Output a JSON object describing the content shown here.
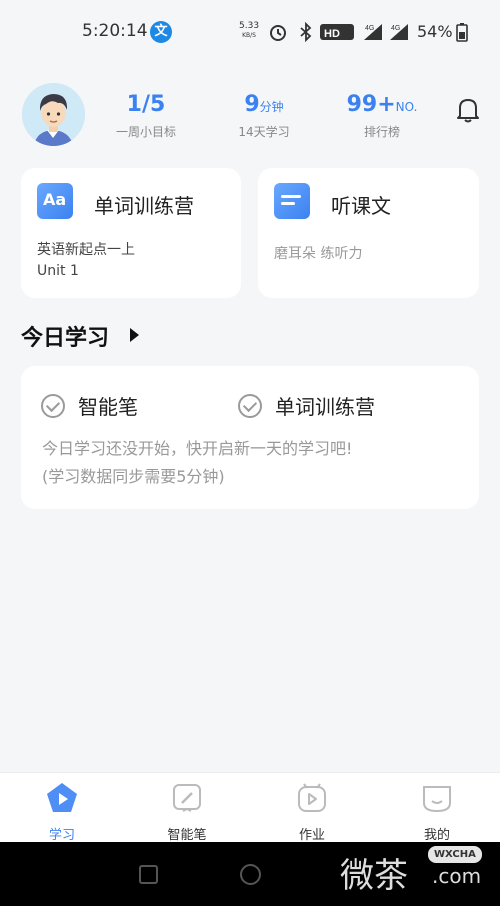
{
  "status": {
    "time": "5:20:14",
    "net_speed_value": "5.33",
    "net_speed_unit": "KB/S",
    "hd_label": "HD",
    "battery": "54%"
  },
  "header": {
    "goal_value": "1/5",
    "goal_label": "一周小目标",
    "minutes_value": "9",
    "minutes_unit": "分钟",
    "minutes_label": "14天学习",
    "rank_value": "99+",
    "rank_unit": "NO.",
    "rank_label": "排行榜"
  },
  "cards": {
    "left": {
      "icon_text": "Aa",
      "title": "单词训练营",
      "sub1": "英语新起点一上",
      "sub2": "Unit 1"
    },
    "right": {
      "title": "听课文",
      "sub": "磨耳朵 练听力"
    }
  },
  "today": {
    "section_title": "今日学习",
    "item1": "智能笔",
    "item2": "单词训练营",
    "msg1": "今日学习还没开始，快开启新一天的学习吧!",
    "msg2": "(学习数据同步需要5分钟)"
  },
  "nav": {
    "items": [
      {
        "label": "学习",
        "icon": "play-pentagon-icon",
        "active": true
      },
      {
        "label": "智能笔",
        "icon": "pen-icon",
        "active": false
      },
      {
        "label": "作业",
        "icon": "homework-icon",
        "active": false
      },
      {
        "label": "我的",
        "icon": "profile-icon",
        "active": false
      }
    ]
  },
  "watermark": {
    "text": "微茶",
    "badge": "WXCHA",
    "com": ".com"
  },
  "colors": {
    "accent": "#3b82f0",
    "background": "#f5f6f8"
  }
}
